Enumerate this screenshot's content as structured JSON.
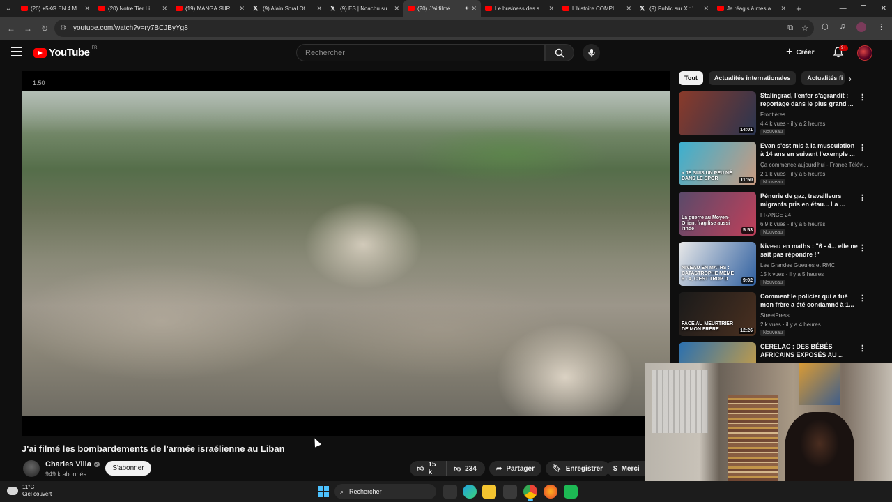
{
  "browser": {
    "tabs": [
      {
        "label": "(20) +5KG EN 4 M",
        "icon": "youtube"
      },
      {
        "label": "(20) Notre Tier Li",
        "icon": "youtube"
      },
      {
        "label": "(19) MANGA SÛR",
        "icon": "youtube"
      },
      {
        "label": "(9) Alain Soral Of",
        "icon": "x"
      },
      {
        "label": "(9) ES | Noachu su",
        "icon": "x"
      },
      {
        "label": "(20) J'ai filmé",
        "icon": "youtube",
        "active": true
      },
      {
        "label": "Le business des s",
        "icon": "youtube"
      },
      {
        "label": "L'histoire COMPL",
        "icon": "youtube"
      },
      {
        "label": "(9) Public sur X : '",
        "icon": "x"
      },
      {
        "label": "Je réagis à mes a",
        "icon": "youtube"
      }
    ],
    "url": "youtube.com/watch?v=ry7BCJByYg8"
  },
  "youtube": {
    "logo_text": "YouTube",
    "country": "FR",
    "search_placeholder": "Rechercher",
    "create_label": "Créer",
    "notif_count": "9+"
  },
  "player": {
    "speed": "1.50"
  },
  "video": {
    "title": "J'ai filmé les bombardements de l'armée israélienne au Liban",
    "channel": "Charles Villa",
    "subscribers": "949 k abonnés",
    "subscribe_label": "S'abonner",
    "likes": "15 k",
    "dislikes": "234",
    "share_label": "Partager",
    "save_label": "Enregistrer",
    "thanks_label": "Merci"
  },
  "chips": [
    "Tout",
    "Actualités internationales",
    "Actualités fi"
  ],
  "suggestions": [
    {
      "title": "Stalingrad, l'enfer s'agrandit : reportage dans le plus grand ...",
      "channel": "Frontières",
      "meta": "4,4 k vues · il y a 2 heures",
      "badge": "Nouveau",
      "duration": "14:01",
      "overlay": "",
      "colors": [
        "#8a3a2a",
        "#2a3550"
      ]
    },
    {
      "title": "Evan s'est mis à la musculation à 14 ans en suivant l'exemple ...",
      "channel": "Ça commence aujourd'hui - France Télévi...",
      "meta": "2,1 k vues · il y a 5 heures",
      "badge": "Nouveau",
      "duration": "11:50",
      "overlay": "« JE SUIS UN PEU NÉ DANS LE SPOR",
      "colors": [
        "#3ab0d0",
        "#c99a80"
      ]
    },
    {
      "title": "Pénurie de gaz, travailleurs migrants pris en étau... La ...",
      "channel": "FRANCE 24",
      "meta": "6,9 k vues · il y a 5 heures",
      "badge": "Nouveau",
      "duration": "5:53",
      "overlay": "La guerre au Moyen-Orient fragilise aussi l'Inde",
      "colors": [
        "#5a4a6a",
        "#c0405a"
      ]
    },
    {
      "title": "Niveau en maths : \"6 - 4... elle ne sait pas répondre !\"",
      "channel": "Les Grandes Gueules et RMC",
      "meta": "15 k vues · il y a 5 heures",
      "badge": "Nouveau",
      "duration": "9:02",
      "overlay": "NIVEAU EN MATHS : CATASTROPHE MÊME 6 - 4, C'EST TROP D",
      "colors": [
        "#e8e8e8",
        "#3060a0"
      ]
    },
    {
      "title": "Comment le policier qui a tué mon frère a été condamné à 1...",
      "channel": "StreetPress",
      "meta": "2 k vues · il y a 4 heures",
      "badge": "Nouveau",
      "duration": "12:26",
      "overlay": "FACE AU MEURTRIER DE MON FRÈRE",
      "colors": [
        "#1a1a1a",
        "#4a3020"
      ]
    },
    {
      "title": "CERELAC : DES BÉBÉS AFRICAINS EXPOSÉS AU ...",
      "channel": "",
      "meta": "",
      "badge": "",
      "duration": "",
      "overlay": "",
      "colors": [
        "#2a70b0",
        "#d0a040"
      ]
    }
  ],
  "taskbar": {
    "temp": "11°C",
    "weather": "Ciel couvert",
    "search_label": "Rechercher"
  }
}
